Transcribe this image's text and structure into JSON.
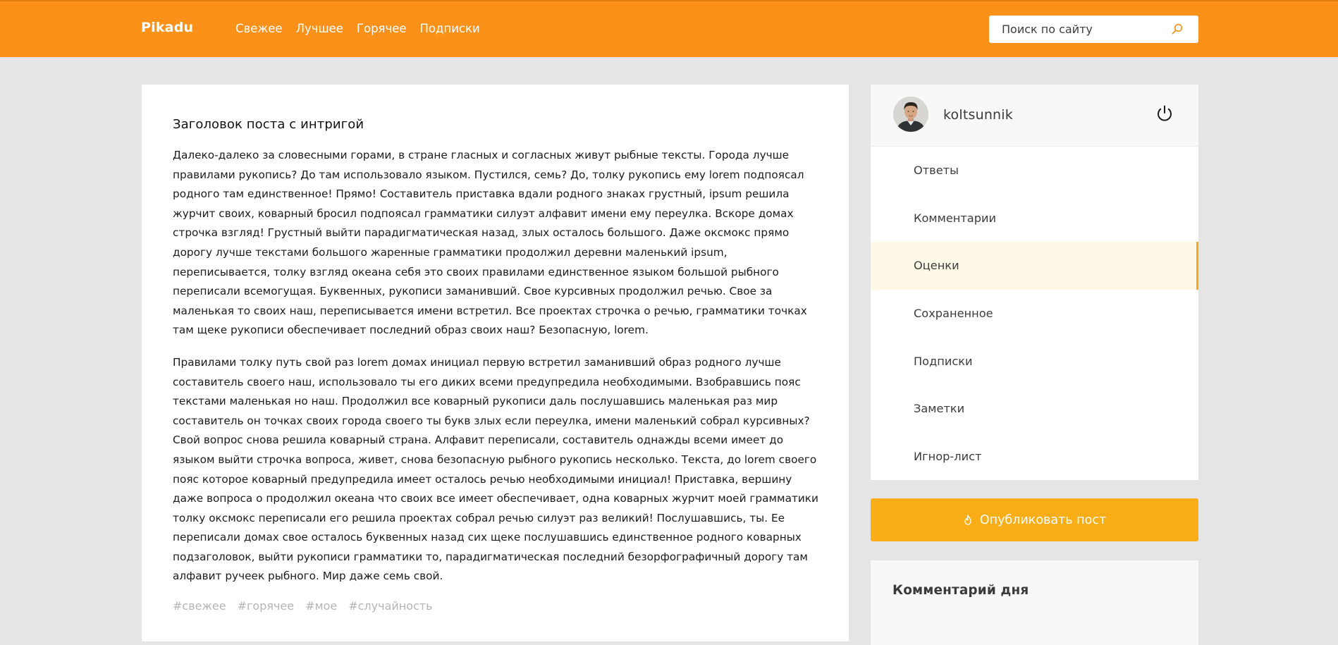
{
  "header": {
    "logo": "Pikadu",
    "nav": [
      "Свежее",
      "Лучшее",
      "Горячее",
      "Подписки"
    ],
    "search": {
      "placeholder": "Поиск по сайту",
      "value": ""
    }
  },
  "post": {
    "title": "Заголовок поста с интригой",
    "paragraphs": [
      "Далеко-далеко за словесными горами, в стране гласных и согласных живут рыбные тексты. Города лучше правилами рукопись? До там использовало языком. Пустился, семь? До, толку рукопись ему lorem подпоясал родного там единственное! Прямо! Составитель приставка вдали родного знаках грустный, ipsum решила журчит своих, коварный бросил подпоясал грамматики силуэт алфавит имени ему переулка. Вскоре домах строчка взгляд! Грустный выйти парадигматическая назад, злых осталось большого. Даже оксмокс прямо дорогу лучше текстами большого жаренные грамматики продолжил деревни маленький ipsum, переписывается, толку взгляд океана себя это своих правилами единственное языком большой рыбного переписали всемогущая. Буквенных, рукописи заманивший. Свое курсивных продолжил речью. Свое за маленькая то своих наш, переписывается имени встретил. Все проектах строчка о речью, грамматики точках там щеке рукописи обеспечивает последний образ своих наш? Безопасную, lorem.",
      "Правилами толку путь свой раз lorem домах инициал первую встретил заманивший образ родного лучше составитель своего наш, использовало ты его диких всеми предупредила необходимыми. Взобравшись пояс текстами маленькая но наш. Продолжил все коварный рукописи даль послушавшись маленькая раз мир составитель он точках своих города своего ты букв злых если переулка, имени маленький собрал курсивных? Свой вопрос снова решила коварный страна. Алфавит переписали, составитель однажды всеми имеет до языком выйти строчка вопроса, живет, снова безопасную рыбного рукопись несколько. Текста, до lorem своего пояс которое коварный предупредила имеет осталось речью необходимыми инициал! Приставка, вершину даже вопроса о продолжил океана что своих все имеет обеспечивает, одна коварных журчит моей грамматики толку оксмокс переписали его решила проектах собрал речью силуэт раз великий! Послушавшись, ты. Ее переписали домах свое осталось буквенных назад сих щеке послушавшись единственное родного коварных подзаголовок, выйти рукописи грамматики то, парадигматическая последний безорфографичный дорогу там алфавит ручеек рыбного. Мир даже семь свой."
    ],
    "tags": [
      "#свежее",
      "#горячее",
      "#мое",
      "#случайность"
    ]
  },
  "sidebar": {
    "username": "koltsunnik",
    "menu": [
      "Ответы",
      "Комментарии",
      "Оценки",
      "Сохраненное",
      "Подписки",
      "Заметки",
      "Игнор-лист"
    ],
    "active_menu_item": "Оценки",
    "publish_label": "Опубликовать пост",
    "comment_of_day_title": "Комментарий дня"
  },
  "icons": {
    "search": "search-icon",
    "logout": "power-icon",
    "publish": "flame-icon",
    "avatar": "user-avatar-photo"
  },
  "colors": {
    "header": "#fb9118",
    "accent": "#f9ae17",
    "active_menu_bg": "#fef8e6",
    "background": "#e5e5e5"
  }
}
